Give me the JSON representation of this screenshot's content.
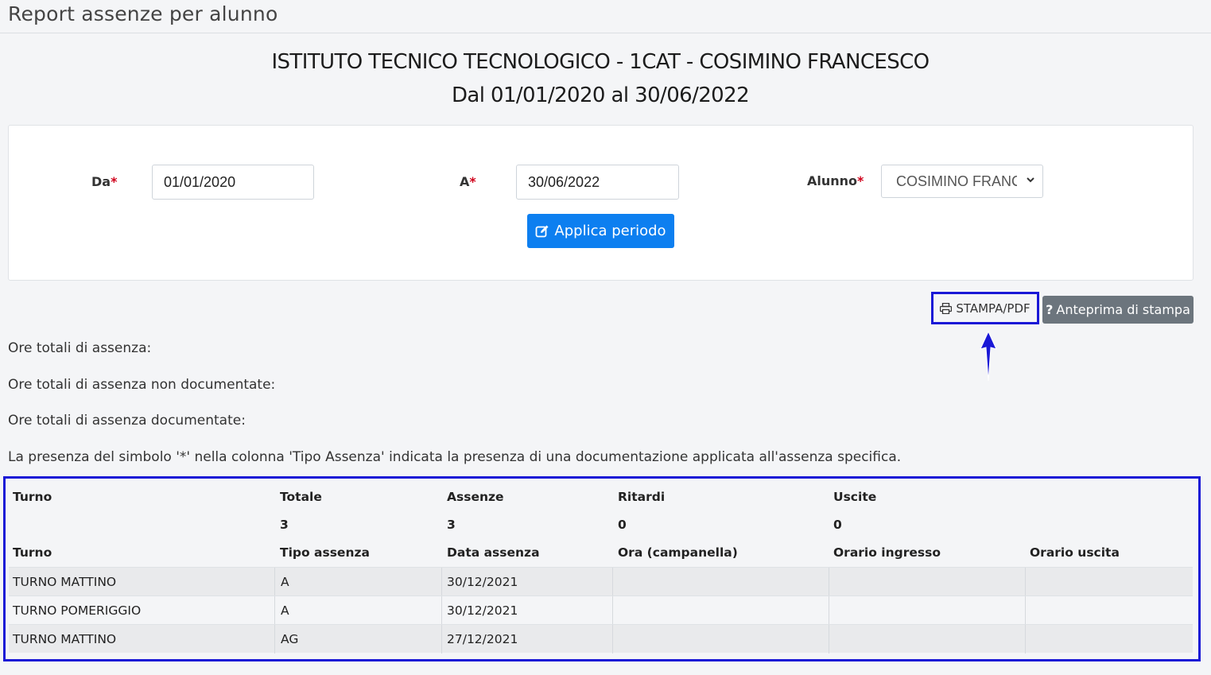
{
  "page": {
    "title": "Report assenze per alunno"
  },
  "heading": {
    "line1": "ISTITUTO TECNICO TECNOLOGICO - 1CAT - COSIMINO FRANCESCO",
    "line2": "Dal 01/01/2020 al 30/06/2022"
  },
  "form": {
    "da_label": "Da",
    "da_value": "01/01/2020",
    "a_label": "A",
    "a_value": "30/06/2022",
    "alunno_label": "Alunno",
    "alunno_value": "COSIMINO FRANCESCO",
    "required_mark": "*",
    "apply_button": "Applica periodo"
  },
  "toolbar": {
    "print_button": "STAMPA/PDF",
    "preview_button": "Anteprima di stampa"
  },
  "info": {
    "ore_totali": "Ore totali di assenza:",
    "ore_non_doc": "Ore totali di assenza non documentate:",
    "ore_doc": "Ore totali di assenza documentate:",
    "note": "La presenza del simbolo '*' nella colonna 'Tipo Assenza' indicata la presenza di una documentazione applicata all'assenza specifica."
  },
  "summary": {
    "headers": [
      "Turno",
      "Totale",
      "Assenze",
      "Ritardi",
      "Uscite"
    ],
    "values": [
      "",
      "3",
      "3",
      "0",
      "0"
    ]
  },
  "detail": {
    "headers": [
      "Turno",
      "Tipo assenza",
      "Data assenza",
      "Ora (campanella)",
      "Orario ingresso",
      "Orario uscita"
    ],
    "rows": [
      [
        "TURNO MATTINO",
        "A",
        "30/12/2021",
        "",
        "",
        ""
      ],
      [
        "TURNO POMERIGGIO",
        "A",
        "30/12/2021",
        "",
        "",
        ""
      ],
      [
        "TURNO MATTINO",
        "AG",
        "27/12/2021",
        "",
        "",
        ""
      ]
    ]
  },
  "colors": {
    "primary": "#0d7ff0",
    "secondary": "#6c757d",
    "highlight": "#1a18d6",
    "required": "#d0021b"
  }
}
